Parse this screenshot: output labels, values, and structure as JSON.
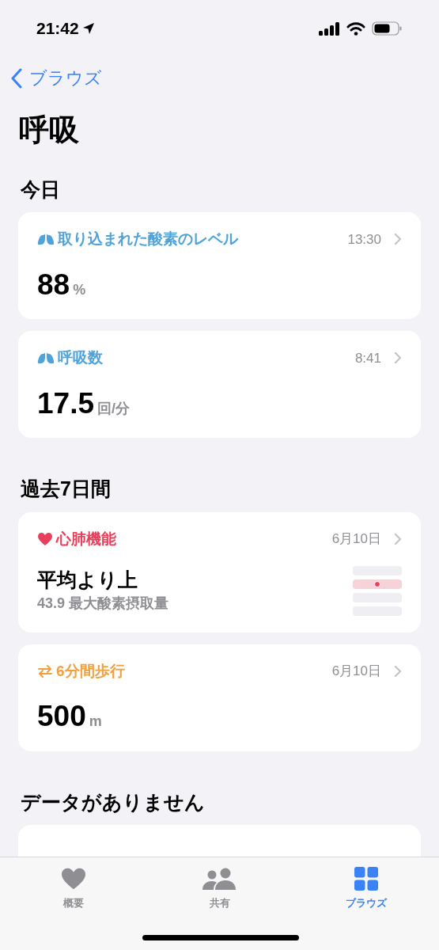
{
  "status_bar": {
    "time": "21:42"
  },
  "nav": {
    "back": "ブラウズ"
  },
  "title": "呼吸",
  "sections": [
    {
      "heading": "今日",
      "cards": [
        {
          "kind": "value",
          "color": "#4fa3d9",
          "title": "取り込まれた酸素のレベル",
          "time": "13:30",
          "value": "88",
          "unit": "%"
        },
        {
          "kind": "value",
          "color": "#4fa3d9",
          "title": "呼吸数",
          "time": "8:41",
          "value": "17.5",
          "unit": "回/分"
        }
      ]
    },
    {
      "heading": "過去7日間",
      "cards": [
        {
          "kind": "rating",
          "color": "#e8405a",
          "title": "心肺機能",
          "time": "6月10日",
          "headline": "平均より上",
          "subtitle": "43.9 最大酸素摂取量",
          "bands": [
            {
              "selected": false
            },
            {
              "selected": true
            },
            {
              "selected": false
            },
            {
              "selected": false
            }
          ]
        },
        {
          "kind": "value",
          "color": "#f0a03c",
          "title": "6分間歩行",
          "time": "6月10日",
          "value": "500",
          "unit": "m"
        }
      ]
    },
    {
      "heading": "データがありません",
      "cards": [
        {
          "kind": "link"
        }
      ]
    }
  ],
  "tab_bar": [
    {
      "label": "概要",
      "selected": false
    },
    {
      "label": "共有",
      "selected": false
    },
    {
      "label": "ブラウズ",
      "selected": true
    }
  ]
}
